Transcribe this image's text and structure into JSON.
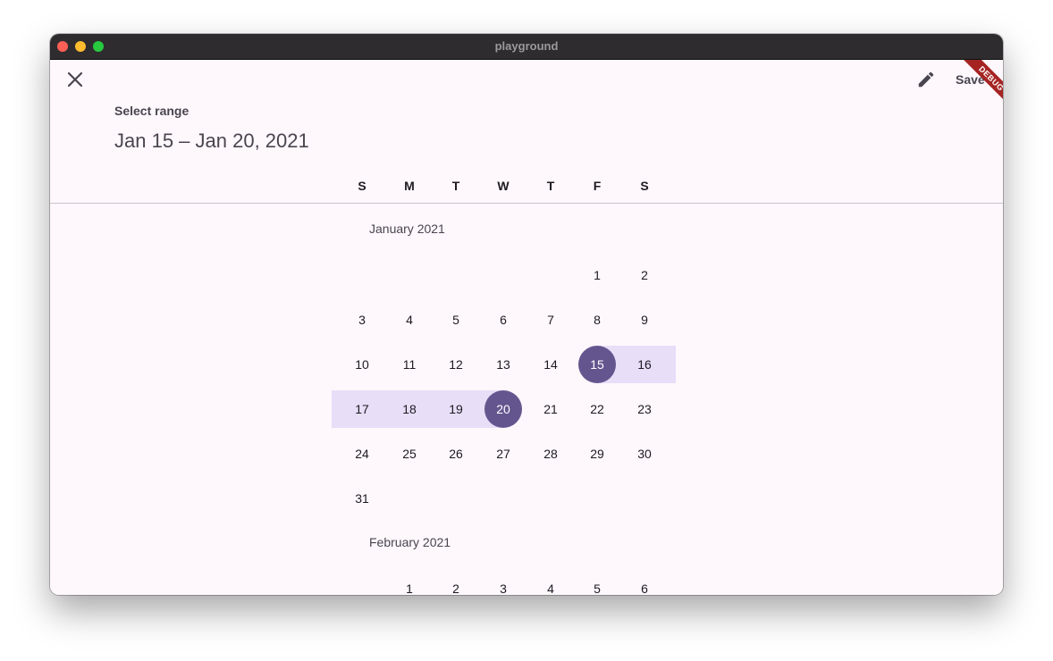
{
  "window": {
    "title": "playground"
  },
  "header": {
    "help_text": "Select range",
    "range_text": "Jan 15 – Jan 20, 2021",
    "save_label": "Save",
    "close_icon": "close-icon",
    "edit_icon": "pencil-icon"
  },
  "weekdays": [
    "S",
    "M",
    "T",
    "W",
    "T",
    "F",
    "S"
  ],
  "months": [
    {
      "label": "January 2021",
      "rows": [
        [
          "",
          "",
          "",
          "",
          "",
          "1",
          "2"
        ],
        [
          "3",
          "4",
          "5",
          "6",
          "7",
          "8",
          "9"
        ],
        [
          "10",
          "11",
          "12",
          "13",
          "14",
          "15",
          "16"
        ],
        [
          "17",
          "18",
          "19",
          "20",
          "21",
          "22",
          "23"
        ],
        [
          "24",
          "25",
          "26",
          "27",
          "28",
          "29",
          "30"
        ],
        [
          "31",
          "",
          "",
          "",
          "",
          "",
          ""
        ]
      ]
    },
    {
      "label": "February 2021",
      "rows": [
        [
          "",
          "1",
          "2",
          "3",
          "4",
          "5",
          "6"
        ]
      ]
    }
  ],
  "selection": {
    "start": "15",
    "end": "20"
  },
  "debug_label": "DEBUG",
  "colors": {
    "selected": "#65558f",
    "range": "#e8def8",
    "background": "#fef7fc"
  }
}
